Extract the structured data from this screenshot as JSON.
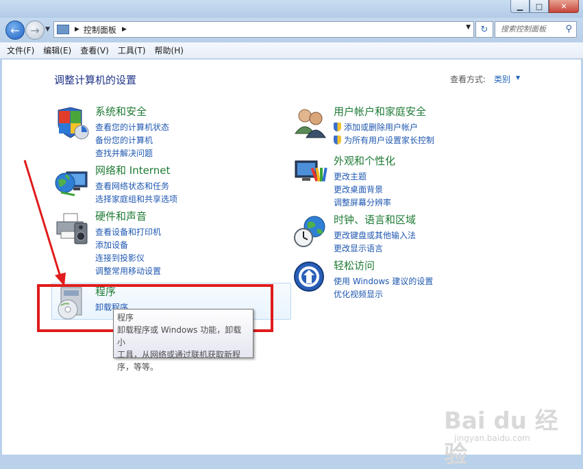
{
  "window": {
    "min_symbol": "▁",
    "max_symbol": "□",
    "close_symbol": "✕"
  },
  "nav": {
    "back_symbol": "←",
    "forward_symbol": "→",
    "address_path": "控制面板",
    "refresh_symbol": "↻",
    "search_placeholder": "搜索控制面板",
    "search_symbol": "⚲"
  },
  "menu": [
    "文件(F)",
    "编辑(E)",
    "查看(V)",
    "工具(T)",
    "帮助(H)"
  ],
  "content": {
    "page_title": "调整计算机的设置",
    "view_by_label": "查看方式:",
    "view_by_value": "类别"
  },
  "categories_left": [
    {
      "icon": "security-shield-icon",
      "title": "系统和安全",
      "links": [
        "查看您的计算机状态",
        "备份您的计算机",
        "查找并解决问题"
      ]
    },
    {
      "icon": "network-globe-icon",
      "title": "网络和 Internet",
      "links": [
        "查看网络状态和任务",
        "选择家庭组和共享选项"
      ]
    },
    {
      "icon": "printer-speaker-icon",
      "title": "硬件和声音",
      "links": [
        "查看设备和打印机",
        "添加设备",
        "连接到投影仪",
        "调整常用移动设置"
      ]
    },
    {
      "icon": "programs-disc-icon",
      "title": "程序",
      "links": [
        "卸载程序"
      ]
    }
  ],
  "categories_right": [
    {
      "icon": "users-icon",
      "title": "用户帐户和家庭安全",
      "links": [
        "添加或删除用户帐户",
        "为所有用户设置家长控制"
      ]
    },
    {
      "icon": "appearance-monitor-icon",
      "title": "外观和个性化",
      "links": [
        "更改主题",
        "更改桌面背景",
        "调整屏幕分辨率"
      ]
    },
    {
      "icon": "clock-globe-icon",
      "title": "时钟、语言和区域",
      "links": [
        "更改键盘或其他输入法",
        "更改显示语言"
      ]
    },
    {
      "icon": "ease-of-access-icon",
      "title": "轻松访问",
      "links": [
        "使用 Windows 建议的设置",
        "优化视频显示"
      ]
    }
  ],
  "tooltip": {
    "title": "程序",
    "line1": "卸载程序或 Windows 功能，卸载小",
    "line2": "工具，从网络或通过联机获取新程",
    "line3": "序，等等。"
  },
  "watermark": {
    "brand": "Bai du 经验",
    "url": "jingyan.baidu.com"
  },
  "colors": {
    "category_title": "#1e7a34",
    "link": "#1e57b0",
    "page_title": "#1e3287",
    "annotation_red": "#e01b1b"
  }
}
